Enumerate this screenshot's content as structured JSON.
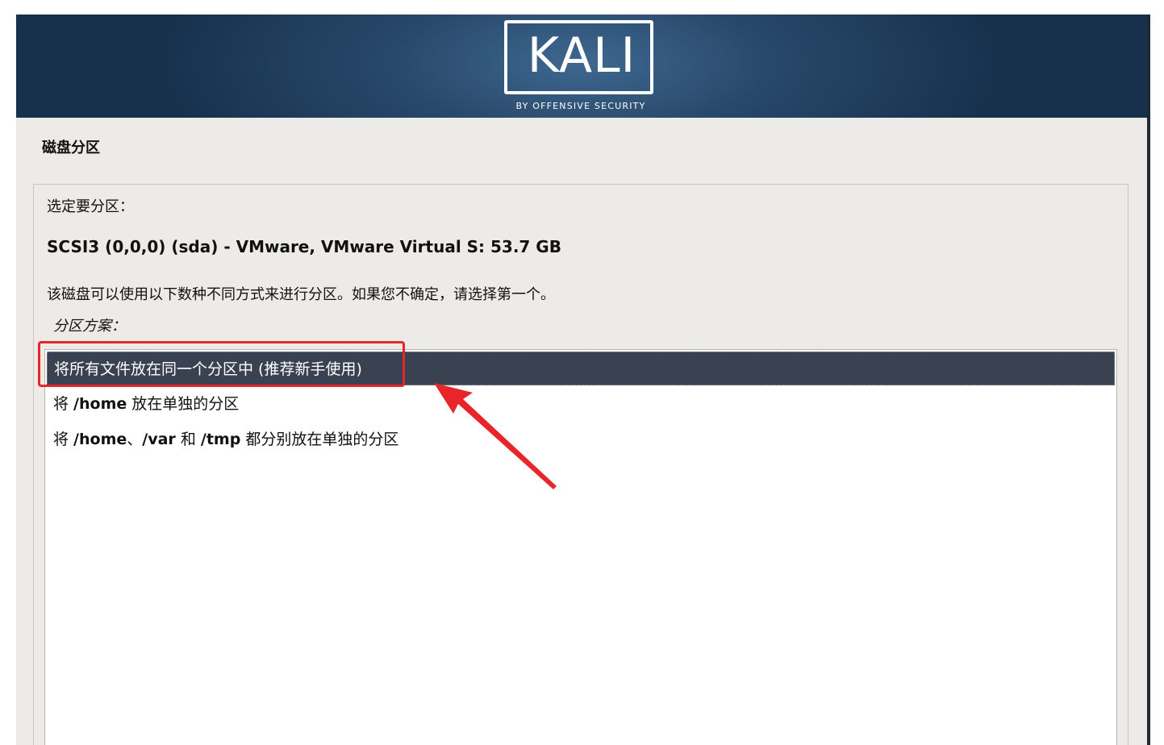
{
  "header": {
    "logo_text": "KALI",
    "logo_subtitle": "BY OFFENSIVE SECURITY"
  },
  "page": {
    "title": "磁盘分区"
  },
  "main": {
    "prompt": "选定要分区：",
    "disk": "SCSI3 (0,0,0) (sda) - VMware, VMware Virtual S: 53.7 GB",
    "description": "该磁盘可以使用以下数种不同方式来进行分区。如果您不确定，请选择第一个。",
    "scheme_label": "分区方案：",
    "options": [
      {
        "label": "将所有文件放在同一个分区中 (推荐新手使用)",
        "selected": true
      },
      {
        "prefix": "将 ",
        "path": "/home",
        "suffix": " 放在单独的分区",
        "selected": false
      },
      {
        "prefix": "将 ",
        "path_home": "/home",
        "sep1": "、",
        "path_var": "/var",
        "sep2": " 和 ",
        "path_tmp": "/tmp",
        "suffix": " 都分别放在单独的分区",
        "selected": false
      }
    ]
  },
  "annotation": {
    "highlight_color": "#e8262a",
    "arrow_color": "#e8262a"
  },
  "colors": {
    "banner": "#28486a",
    "selected_row": "#3a4150",
    "background": "#edebe8"
  }
}
